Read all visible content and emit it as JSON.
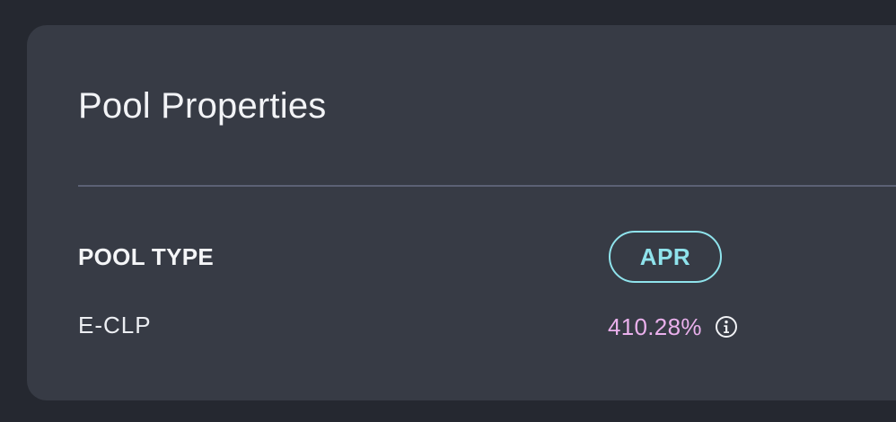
{
  "card": {
    "title": "Pool Properties"
  },
  "pool_type": {
    "label": "POOL TYPE",
    "value": "E-CLP"
  },
  "apr": {
    "label": "APR",
    "value": "410.28%",
    "info_icon": "info-icon"
  },
  "colors": {
    "page_background": "#252830",
    "card_background": "#373b45",
    "divider": "#5c6175",
    "apr_accent": "#8fe3ec",
    "apr_value": "#eab0ec"
  }
}
